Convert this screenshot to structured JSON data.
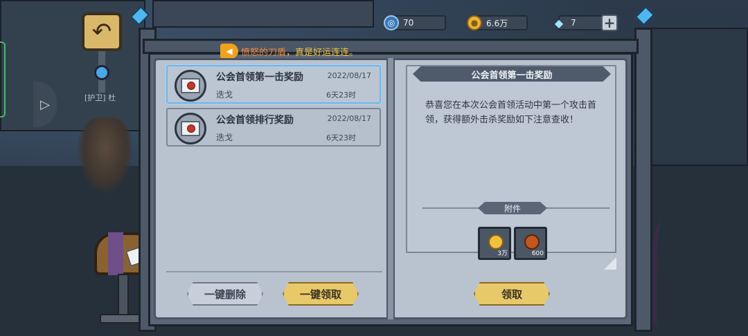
{
  "hud": {
    "energy": "70",
    "gold": "6.6万",
    "gems": "7",
    "plus_label": "+",
    "icons": {
      "energy": "energy-orb-icon",
      "gold": "gold-coin-icon",
      "gems": "diamond-icon",
      "plus": "plus-icon"
    }
  },
  "notice": {
    "prefix": "愤怒的刀盾",
    "suffix": "，真是好运连连。",
    "icon": "horn-icon"
  },
  "scene": {
    "guard_label": "[护卫] 杜",
    "back_glyph": "↶"
  },
  "mail_list": [
    {
      "title": "公会首领第一击奖励",
      "date": "2022/08/17",
      "sender": "迭戈",
      "expire": "6天23时",
      "selected": true
    },
    {
      "title": "公会首领排行奖励",
      "date": "2022/08/17",
      "sender": "迭戈",
      "expire": "6天23时",
      "selected": false
    }
  ],
  "buttons": {
    "delete_all": "一键删除",
    "claim_all": "一键领取",
    "claim": "领取"
  },
  "detail": {
    "title": "公会首领第一击奖励",
    "body": "恭喜您在本次公会首领活动中第一个攻击首领，获得额外击杀奖励如下注意查收！",
    "attachments_label": "附件",
    "attachments": [
      {
        "icon": "gold-coin-icon",
        "qty": "3万"
      },
      {
        "icon": "guild-crest-icon",
        "qty": "600"
      }
    ]
  },
  "colors": {
    "accent_gold": "#e8c96a",
    "notice_text": "#f4c542",
    "selected_border": "#6fb5e8"
  }
}
